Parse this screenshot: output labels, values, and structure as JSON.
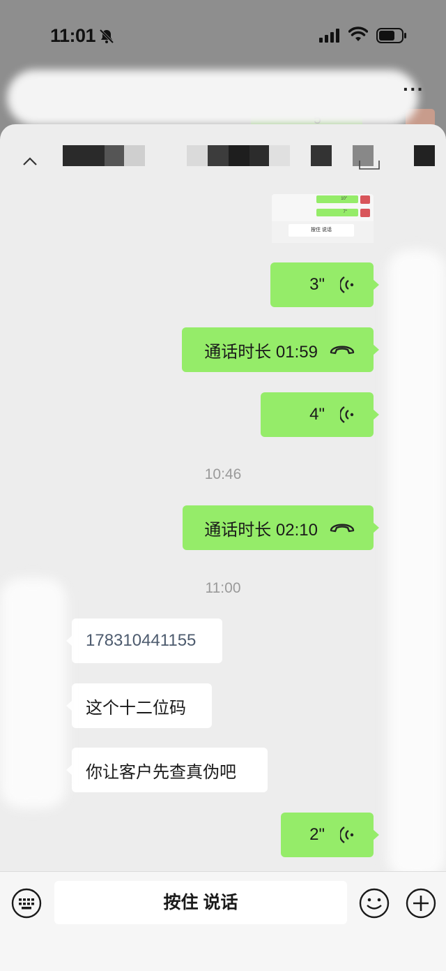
{
  "status_bar": {
    "time": "11:01"
  },
  "background_chat": {
    "voice_duration": "5\""
  },
  "thumbnail": {
    "bubble_1": "10\"",
    "bubble_2": "7\"",
    "button": "按住 说话"
  },
  "messages": [
    {
      "id": "voice-3",
      "direction": "out",
      "type": "voice",
      "text": "3\""
    },
    {
      "id": "call-1",
      "direction": "out",
      "type": "call",
      "text": "通话时长 01:59"
    },
    {
      "id": "voice-4",
      "direction": "out",
      "type": "voice",
      "text": "4\""
    },
    {
      "id": "time-1",
      "type": "timestamp",
      "text": "10:46"
    },
    {
      "id": "call-2",
      "direction": "out",
      "type": "call",
      "text": "通话时长 02:10"
    },
    {
      "id": "time-2",
      "type": "timestamp",
      "text": "11:00"
    },
    {
      "id": "text-1",
      "direction": "in",
      "type": "text",
      "text": "178310441155"
    },
    {
      "id": "text-2",
      "direction": "in",
      "type": "text",
      "text": "这个十二位码"
    },
    {
      "id": "text-3",
      "direction": "in",
      "type": "text",
      "text": "你让客户先查真伪吧"
    },
    {
      "id": "voice-2",
      "direction": "out",
      "type": "voice",
      "text": "2\""
    }
  ],
  "input_bar": {
    "hold_to_talk": "按住 说话"
  },
  "colors": {
    "outgoing_bubble": "#95ec69",
    "incoming_bubble": "#ffffff",
    "chat_background": "#ededed"
  },
  "icons": [
    "bell-slash-icon",
    "signal-icon",
    "wifi-icon",
    "battery-icon",
    "more-icon",
    "voice-wave-icon",
    "phone-hangup-icon",
    "keyboard-icon",
    "emoji-icon",
    "plus-icon",
    "collapse-icon"
  ]
}
